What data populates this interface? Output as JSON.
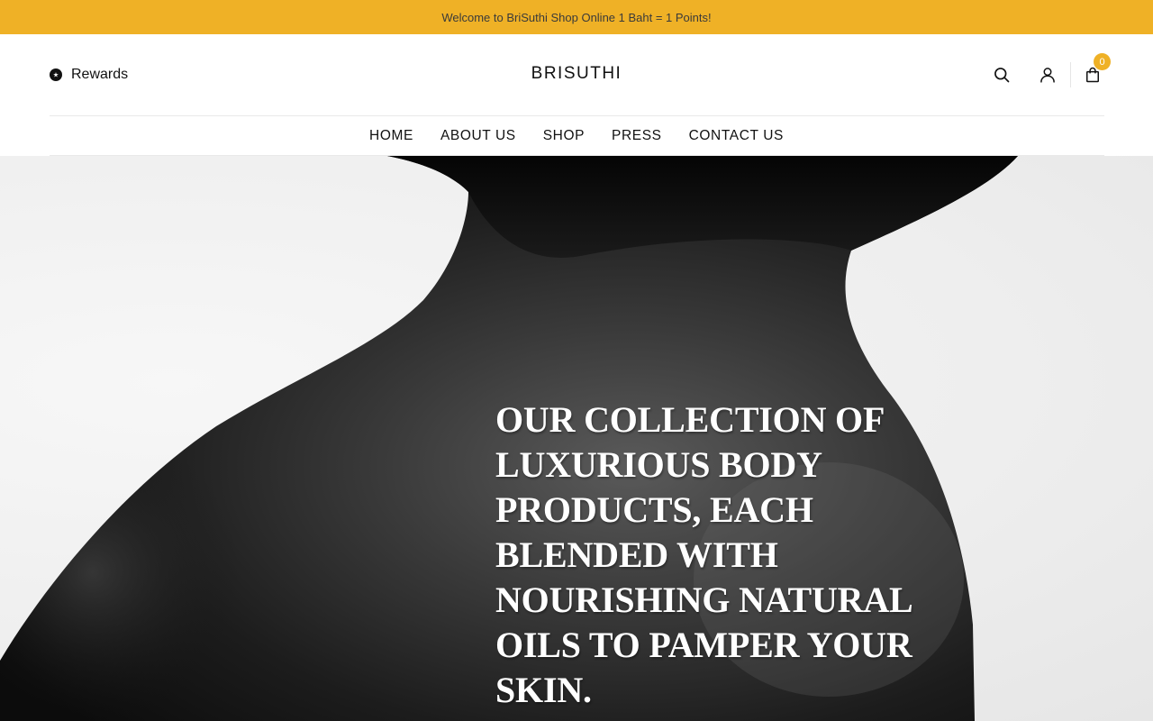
{
  "announcement": "Welcome to BriSuthi Shop Online 1 Baht = 1 Points!",
  "header": {
    "rewards_label": "Rewards",
    "logo": "BRISUTHI",
    "cart_count": "0"
  },
  "nav": {
    "items": [
      "HOME",
      "ABOUT US",
      "SHOP",
      "PRESS",
      "CONTACT US"
    ]
  },
  "hero": {
    "headline": "OUR COLLECTION OF LUXURIOUS BODY PRODUCTS, EACH BLENDED WITH NOURISHING NATURAL OILS TO PAMPER YOUR SKIN."
  },
  "colors": {
    "accent": "#efb126",
    "text": "#111111",
    "hero_text": "#ffffff"
  },
  "icons": [
    "star-icon",
    "search-icon",
    "account-icon",
    "shopping-bag-icon"
  ]
}
